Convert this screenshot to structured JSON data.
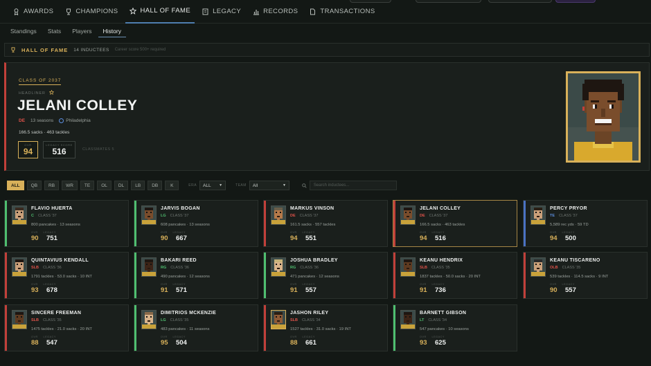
{
  "nav": {
    "tabs": [
      {
        "label": "AWARDS",
        "icon": "ribbon-icon"
      },
      {
        "label": "CHAMPIONS",
        "icon": "trophy-icon"
      },
      {
        "label": "HALL OF FAME",
        "icon": "star-icon",
        "active": true
      },
      {
        "label": "LEGACY",
        "icon": "book-icon"
      },
      {
        "label": "RECORDS",
        "icon": "bar-chart-icon"
      },
      {
        "label": "TRANSACTIONS",
        "icon": "document-icon"
      }
    ],
    "subtabs": [
      "Standings",
      "Stats",
      "Players",
      "History"
    ],
    "active_subtab": "History"
  },
  "hof_bar": {
    "title": "HALL OF FAME",
    "count": "14 INDUCTEES",
    "note": "Career score 500+ required"
  },
  "featured": {
    "class_tag": "CLASS OF 2037",
    "headliner": "HEADLINER",
    "name": "JELANI COLLEY",
    "position": "DE",
    "seasons": "13 seasons",
    "team": "Philadelphia",
    "statline": "166.5 sacks · 463 tackles",
    "ovr_label": "OVR",
    "ovr": "94",
    "legacy_label": "LEGACY SCORE",
    "legacy": "516",
    "classmates": "CLASSMATES 5"
  },
  "filters": {
    "positions": [
      "ALL",
      "QB",
      "RB",
      "WR",
      "TE",
      "OL",
      "DL",
      "LB",
      "DB",
      "K"
    ],
    "active": "ALL",
    "era_label": "ERA",
    "era_value": "ALL",
    "team_label": "TEAM",
    "team_value": "All",
    "search_placeholder": "Search inductees..."
  },
  "card_labels": {
    "ovr": "OVR",
    "legacy": "LEGACY"
  },
  "cards": [
    {
      "name": "FLAVIO HUERTA",
      "pos": "C",
      "cls": "CLASS '37",
      "stats": "800 pancakes · 13 seasons",
      "ovr": "90",
      "legacy": "751",
      "accent": "#4fbf70"
    },
    {
      "name": "JARVIS BOGAN",
      "pos": "LG",
      "cls": "CLASS '37",
      "stats": "608 pancakes · 13 seasons",
      "ovr": "90",
      "legacy": "667",
      "accent": "#4fbf70"
    },
    {
      "name": "MARKUS VINSON",
      "pos": "DE",
      "cls": "CLASS '37",
      "stats": "161.5 sacks · 557 tackles",
      "ovr": "94",
      "legacy": "551",
      "accent": "#c2403a"
    },
    {
      "name": "JELANI COLLEY",
      "pos": "DE",
      "cls": "CLASS '37",
      "stats": "166.5 sacks · 463 tackles",
      "ovr": "94",
      "legacy": "516",
      "accent": "#c2403a",
      "selected": true
    },
    {
      "name": "PERCY PRYOR",
      "pos": "TE",
      "cls": "CLASS '37",
      "stats": "5,589 rec yds · 59 TD",
      "ovr": "94",
      "legacy": "500",
      "accent": "#4a72c4"
    },
    {
      "name": "QUINTAVIUS KENDALL",
      "pos": "SLB",
      "cls": "CLASS '36",
      "stats": "1791 tackles · 53.0 sacks · 10 INT",
      "ovr": "93",
      "legacy": "678",
      "accent": "#c2403a"
    },
    {
      "name": "BAKARI REED",
      "pos": "RG",
      "cls": "CLASS '36",
      "stats": "490 pancakes · 12 seasons",
      "ovr": "91",
      "legacy": "571",
      "accent": "#4fbf70"
    },
    {
      "name": "JOSHUA BRADLEY",
      "pos": "RG",
      "cls": "CLASS '36",
      "stats": "471 pancakes · 12 seasons",
      "ovr": "91",
      "legacy": "557",
      "accent": "#4fbf70"
    },
    {
      "name": "KEANU HENDRIX",
      "pos": "SLB",
      "cls": "CLASS '35",
      "stats": "1837 tackles · 50.0 sacks · 20 INT",
      "ovr": "91",
      "legacy": "736",
      "accent": "#c2403a"
    },
    {
      "name": "KEANU TISCARENO",
      "pos": "OLB",
      "cls": "CLASS '35",
      "stats": "539 tackles · 114.5 sacks · 9 INT",
      "ovr": "90",
      "legacy": "557",
      "accent": "#c2403a"
    },
    {
      "name": "SINCERE FREEMAN",
      "pos": "SLB",
      "cls": "CLASS '35",
      "stats": "1475 tackles · 21.0 sacks · 20 INT",
      "ovr": "88",
      "legacy": "547",
      "accent": "#c2403a"
    },
    {
      "name": "DIMITRIOS MCKENZIE",
      "pos": "LG",
      "cls": "CLASS '35",
      "stats": "483 pancakes · 11 seasons",
      "ovr": "95",
      "legacy": "504",
      "accent": "#4fbf70"
    },
    {
      "name": "JASHON RILEY",
      "pos": "SLB",
      "cls": "CLASS '34",
      "stats": "1527 tackles · 31.0 sacks · 19 INT",
      "ovr": "88",
      "legacy": "661",
      "accent": "#c2403a",
      "gold_frame": true
    },
    {
      "name": "BARNETT GIBSON",
      "pos": "LT",
      "cls": "CLASS '34",
      "stats": "547 pancakes · 10 seasons",
      "ovr": "93",
      "legacy": "625",
      "accent": "#4fbf70"
    }
  ]
}
